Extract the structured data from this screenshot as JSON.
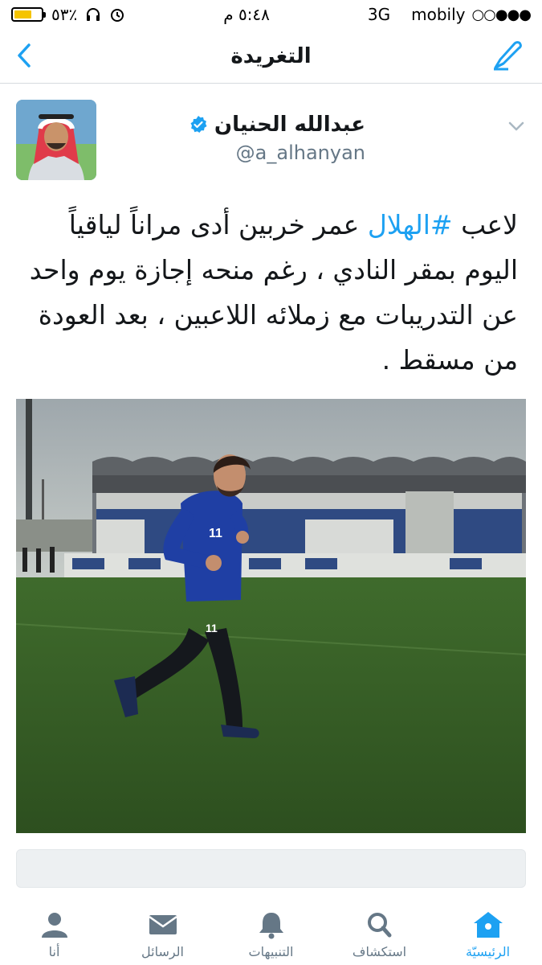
{
  "status_bar": {
    "battery": "٥٣٪",
    "time": "٥:٤٨ م",
    "network": "3G",
    "carrier": "mobily",
    "signal_dots": "○○●●●"
  },
  "nav": {
    "title": "التغريدة"
  },
  "tweet": {
    "display_name": "عبدالله الحنيان",
    "handle": "@a_alhanyan",
    "text_before_hashtag": "لاعب ",
    "hashtag": "#الهلال",
    "text_after_hashtag": " عمر خربين أدى مراناً لياقياً اليوم بمقر النادي ، رغم منحه إجازة يوم واحد عن التدريبات مع زملائه اللاعبين ، بعد العودة من مسقط .",
    "jersey_number": "11"
  },
  "colors": {
    "accent": "#1da1f2",
    "muted": "#657786",
    "text": "#14171a"
  },
  "tab_bar": {
    "items": [
      {
        "label": "الرئيسيّة",
        "icon": "home-icon",
        "active": true
      },
      {
        "label": "استكشاف",
        "icon": "search-icon",
        "active": false
      },
      {
        "label": "التنبيهات",
        "icon": "bell-icon",
        "active": false
      },
      {
        "label": "الرسائل",
        "icon": "envelope-icon",
        "active": false
      },
      {
        "label": "أنا",
        "icon": "profile-icon",
        "active": false
      }
    ]
  }
}
